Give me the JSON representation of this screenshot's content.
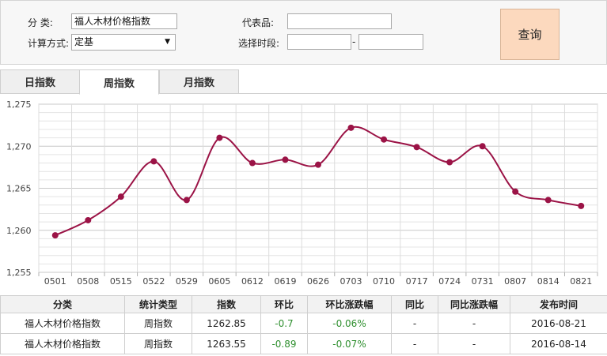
{
  "filter": {
    "category_label": "分 类:",
    "category_value": "福人木材价格指数",
    "method_label": "计算方式:",
    "method_value": "定基",
    "representative_label": "代表品:",
    "representative_value": "",
    "period_label": "选择时段:",
    "period_start": "",
    "period_end": "",
    "period_separator": "-",
    "query_button": "查询"
  },
  "tabs": [
    {
      "label": "日指数",
      "active": false
    },
    {
      "label": "周指数",
      "active": true
    },
    {
      "label": "月指数",
      "active": false
    }
  ],
  "colors": {
    "series_line": "#9b1346",
    "query_button_bg": "#fcd9be",
    "positive_change": "#2f8f2f"
  },
  "chart_data": {
    "type": "line",
    "smooth": true,
    "grid": true,
    "ylim": [
      1255,
      1275
    ],
    "y_ticks": [
      "1,255",
      "1,260",
      "1,265",
      "1,270",
      "1,275"
    ],
    "categories": [
      "0501",
      "0508",
      "0515",
      "0522",
      "0529",
      "0605",
      "0612",
      "0619",
      "0626",
      "0703",
      "0710",
      "0717",
      "0724",
      "0731",
      "0807",
      "0814",
      "0821"
    ],
    "values": [
      1259.4,
      1261.2,
      1264.0,
      1268.2,
      1263.6,
      1271.0,
      1268.0,
      1268.4,
      1267.8,
      1272.2,
      1270.8,
      1269.9,
      1268.1,
      1270.0,
      1264.6,
      1263.6,
      1262.9
    ]
  },
  "table": {
    "headers": [
      "分类",
      "统计类型",
      "指数",
      "环比",
      "环比涨跌幅",
      "同比",
      "同比涨跌幅",
      "发布时间"
    ],
    "rows": [
      [
        "福人木材价格指数",
        "周指数",
        "1262.85",
        "-0.7",
        "-0.06%",
        "-",
        "-",
        "2016-08-21"
      ],
      [
        "福人木材价格指数",
        "周指数",
        "1263.55",
        "-0.89",
        "-0.07%",
        "-",
        "-",
        "2016-08-14"
      ]
    ]
  }
}
